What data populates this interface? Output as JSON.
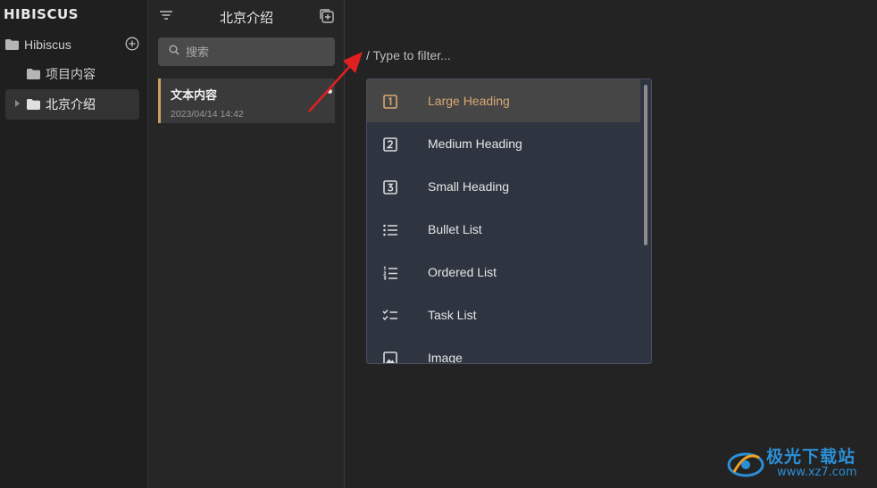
{
  "app": {
    "logo": "HIBISCUS"
  },
  "sidebar": {
    "root": "Hibiscus",
    "children": [
      "项目内容",
      "北京介绍"
    ],
    "selected": "北京介绍"
  },
  "notelist": {
    "title": "北京介绍",
    "search_placeholder": "搜索",
    "notes": [
      {
        "title": "文本内容",
        "date": "2023/04/14 14:42"
      }
    ]
  },
  "editor": {
    "filter_text": "/ Type to filter...",
    "menu": [
      {
        "label": "Large Heading",
        "icon": "heading-1-icon",
        "active": true
      },
      {
        "label": "Medium Heading",
        "icon": "heading-2-icon"
      },
      {
        "label": "Small Heading",
        "icon": "heading-3-icon"
      },
      {
        "label": "Bullet List",
        "icon": "bullet-list-icon"
      },
      {
        "label": "Ordered List",
        "icon": "ordered-list-icon"
      },
      {
        "label": "Task List",
        "icon": "task-list-icon"
      },
      {
        "label": "Image",
        "icon": "image-icon"
      }
    ]
  },
  "colors": {
    "accent": "#d9a872",
    "note_marker": "#c8a062",
    "menu_bg": "#2e3440",
    "annotation_arrow": "#e02020"
  },
  "watermark": {
    "brand": "极光下载站",
    "url": "www.xz7.com"
  }
}
